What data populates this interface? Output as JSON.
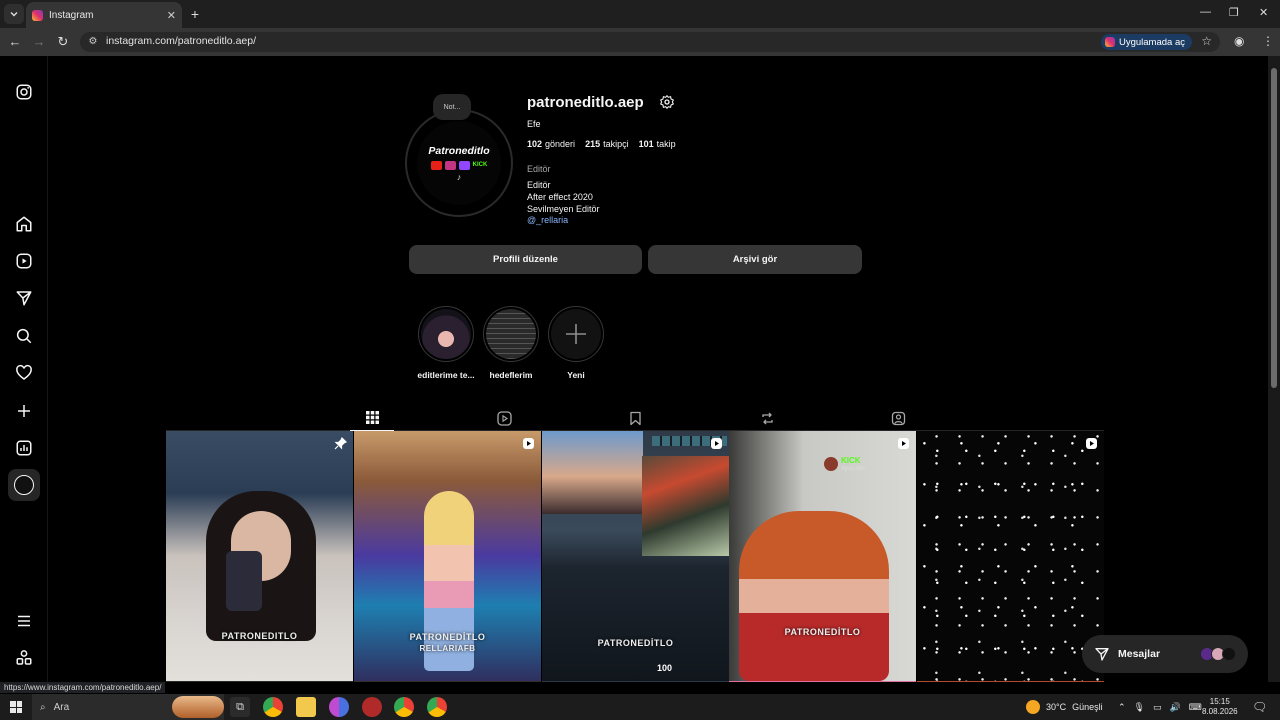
{
  "browser": {
    "tab_title": "Instagram",
    "tab_close": "✕",
    "new_tab": "+",
    "url": "instagram.com/patroneditlo.aep/",
    "open_in_app": "Uygulamada aç",
    "status_url": "https://www.instagram.com/patroneditlo.aep/"
  },
  "profile": {
    "username": "patroneditlo.aep",
    "note": "Not...",
    "full_name": "Efe",
    "posts_count": "102",
    "posts_label": "gönderi",
    "followers_count": "215",
    "followers_label": "takipçi",
    "following_count": "101",
    "following_label": "takip",
    "category": "Editör",
    "bio_lines": [
      "Editör",
      "After effect 2020",
      "Sevilmeyen Editör"
    ],
    "mention": "@_rellaria",
    "avatar_text": "Patroneditlo",
    "avatar_kick": "KICK",
    "edit_profile_button": "Profili düzenle",
    "view_archive_button": "Arşivi gör"
  },
  "highlights": [
    {
      "label": "editlerime te..."
    },
    {
      "label": "hedeflerim"
    },
    {
      "label": "Yeni"
    }
  ],
  "grid": {
    "tiles": [
      {
        "caption": "PATRONEDITLO",
        "badge": "pin"
      },
      {
        "caption": "PATRONEDİTLO",
        "caption2": "RELLARIAFB",
        "badge": "reel"
      },
      {
        "caption": "PATRONEDİTLO",
        "counter": "100",
        "badge": "reel"
      },
      {
        "caption": "PATRONEDİTLO",
        "kick_label": "KICK",
        "kick_sub": "Aysu.Alo",
        "badge": "reel"
      },
      {
        "caption": "",
        "badge": "reel"
      }
    ]
  },
  "messages": {
    "label": "Mesajlar"
  },
  "taskbar": {
    "search": "Ara",
    "weather": "30°C",
    "weather_desc": "Güneşli",
    "time": "15:15",
    "date": "8.08.2026"
  },
  "colors": {
    "background": "#000000",
    "button": "#363636",
    "link": "#8ab4f8",
    "open_app_bg": "#1c3b63"
  }
}
